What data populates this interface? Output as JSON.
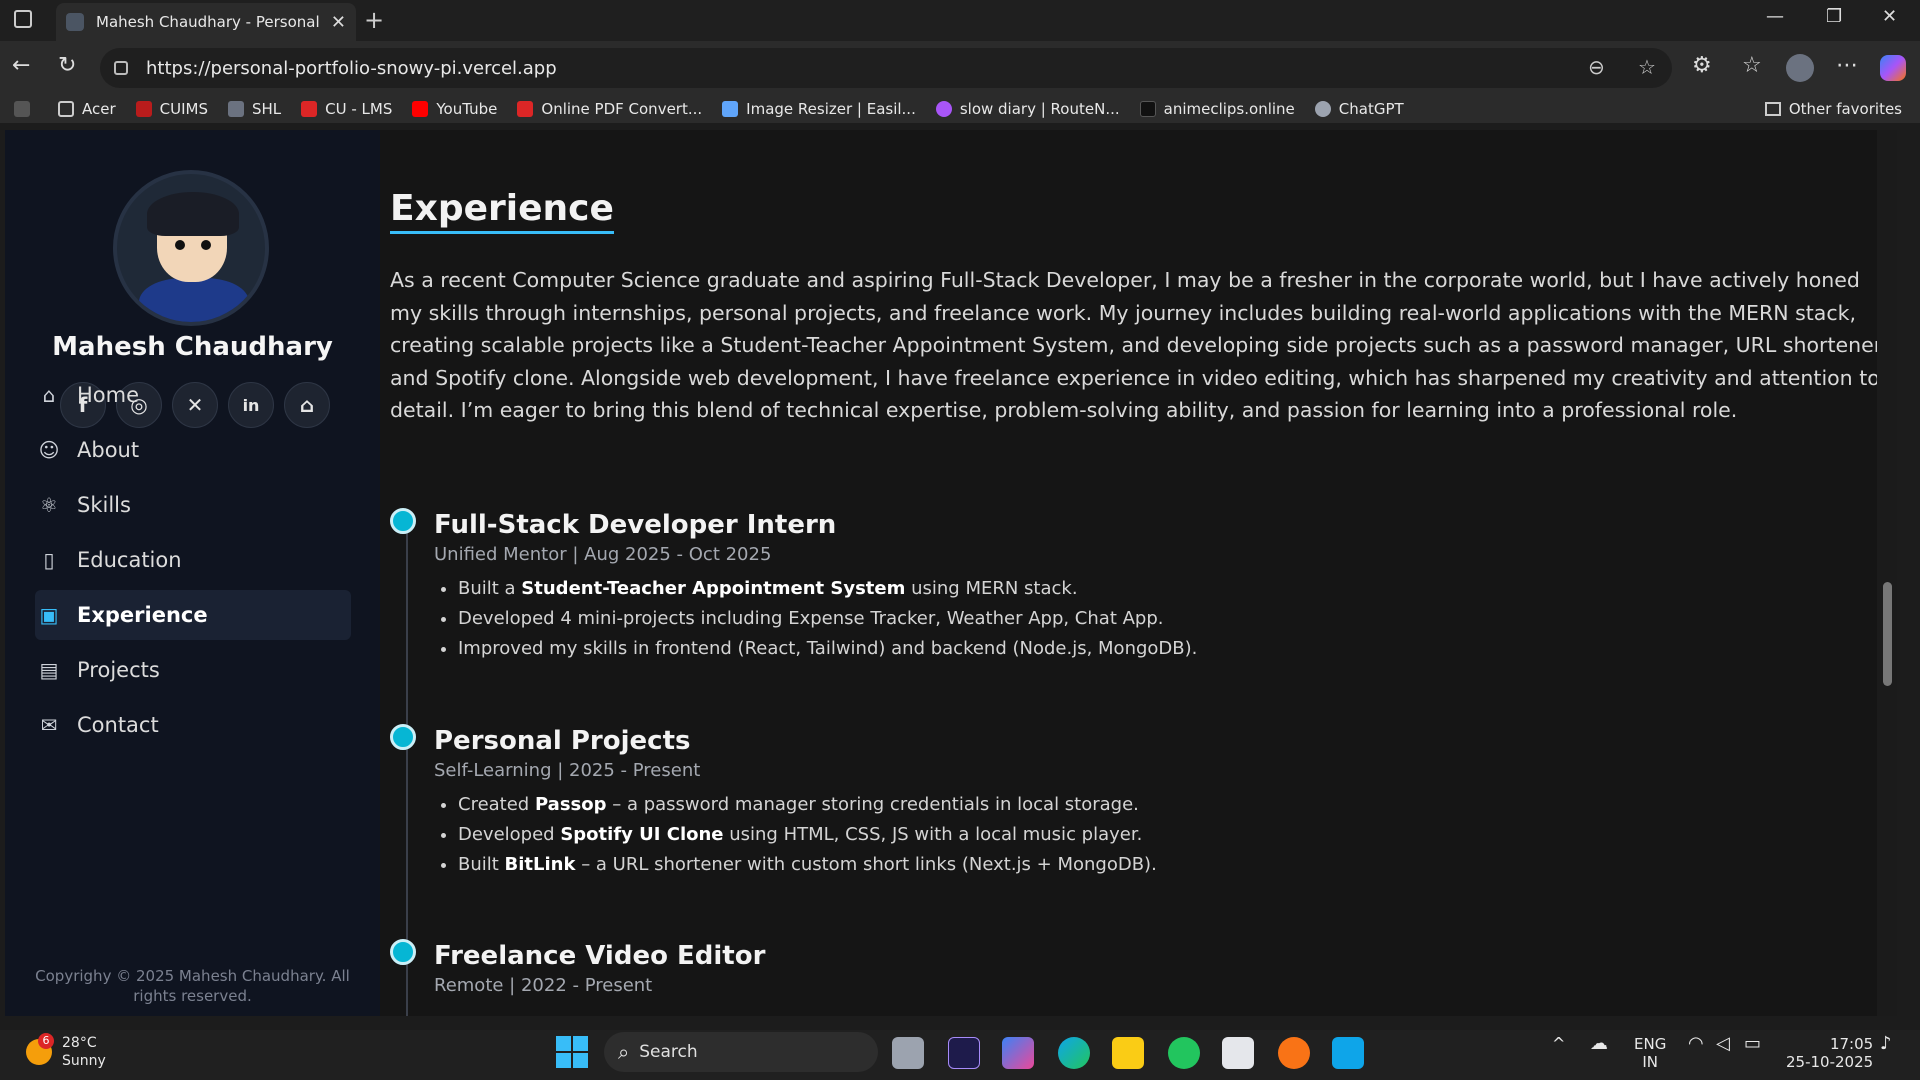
{
  "browser": {
    "tab_title": "Mahesh Chaudhary - Personal Por",
    "url": "https://personal-portfolio-snowy-pi.vercel.app",
    "bookmarks": [
      {
        "label": "Acer",
        "color": "#9ca3af"
      },
      {
        "label": "CUIMS",
        "color": "#b91c1c"
      },
      {
        "label": "SHL",
        "color": "#6b7280"
      },
      {
        "label": "CU - LMS",
        "color": "#dc2626"
      },
      {
        "label": "YouTube",
        "color": "#ff0000"
      },
      {
        "label": "Online PDF Convert...",
        "color": "#dc2626"
      },
      {
        "label": "Image Resizer | Easil...",
        "color": "#60a5fa"
      },
      {
        "label": "slow diary | RouteN...",
        "color": "#a855f7"
      },
      {
        "label": "animeclips.online",
        "color": "#111111"
      },
      {
        "label": "ChatGPT",
        "color": "#9ca3af"
      }
    ],
    "other_favorites": "Other favorites"
  },
  "sidebar": {
    "name": "Mahesh Chaudhary",
    "socials": [
      "facebook-icon",
      "instagram-icon",
      "x-icon",
      "linkedin-icon",
      "github-icon"
    ],
    "menu": [
      {
        "label": "Home",
        "icon": "home-icon"
      },
      {
        "label": "About",
        "icon": "user-icon"
      },
      {
        "label": "Skills",
        "icon": "atom-icon"
      },
      {
        "label": "Education",
        "icon": "book-icon"
      },
      {
        "label": "Experience",
        "icon": "briefcase-icon",
        "active": true
      },
      {
        "label": "Projects",
        "icon": "backpack-icon"
      },
      {
        "label": "Contact",
        "icon": "mail-icon"
      }
    ],
    "copyright_line1": "Copyrighy © 2025 Mahesh Chaudhary. All",
    "copyright_line2": "rights reserved."
  },
  "main": {
    "heading": "Experience",
    "intro": "As a recent Computer Science graduate and aspiring Full-Stack Developer, I may be a fresher in the corporate world, but I have actively honed my skills through internships, personal projects, and freelance work. My journey includes building real-world applications with the MERN stack, creating scalable projects like a Student-Teacher Appointment System, and developing side projects such as a password manager, URL shortener, and Spotify clone. Alongside web development, I have freelance experience in video editing, which has sharpened my creativity and attention to detail. I’m eager to bring this blend of technical expertise, problem-solving ability, and passion for learning into a professional role.",
    "jobs": [
      {
        "title": "Full-Stack Developer Intern",
        "meta": "Unified Mentor | Aug 2025 - Oct 2025",
        "bullets": [
          {
            "pre": "Built a ",
            "bold": "Student-Teacher Appointment System",
            "post": " using MERN stack."
          },
          {
            "pre": "Developed 4 mini-projects including Expense Tracker, Weather App, Chat App.",
            "bold": "",
            "post": ""
          },
          {
            "pre": "Improved my skills in frontend (React, Tailwind) and backend (Node.js, MongoDB).",
            "bold": "",
            "post": ""
          }
        ]
      },
      {
        "title": "Personal Projects",
        "meta": "Self-Learning | 2025 - Present",
        "bullets": [
          {
            "pre": "Created ",
            "bold": "Passop",
            "post": " – a password manager storing credentials in local storage."
          },
          {
            "pre": "Developed ",
            "bold": "Spotify UI Clone",
            "post": " using HTML, CSS, JS with a local music player."
          },
          {
            "pre": "Built ",
            "bold": "BitLink",
            "post": " – a URL shortener with custom short links (Next.js + MongoDB)."
          }
        ]
      },
      {
        "title": "Freelance Video Editor",
        "meta": "Remote | 2022 - Present",
        "bullets": []
      }
    ]
  },
  "taskbar": {
    "weather_temp": "28°C",
    "weather_desc": "Sunny",
    "weather_badge": "6",
    "search_label": "Search",
    "lang_line1": "ENG",
    "lang_line2": "IN",
    "time": "17:05",
    "date": "25-10-2025"
  }
}
